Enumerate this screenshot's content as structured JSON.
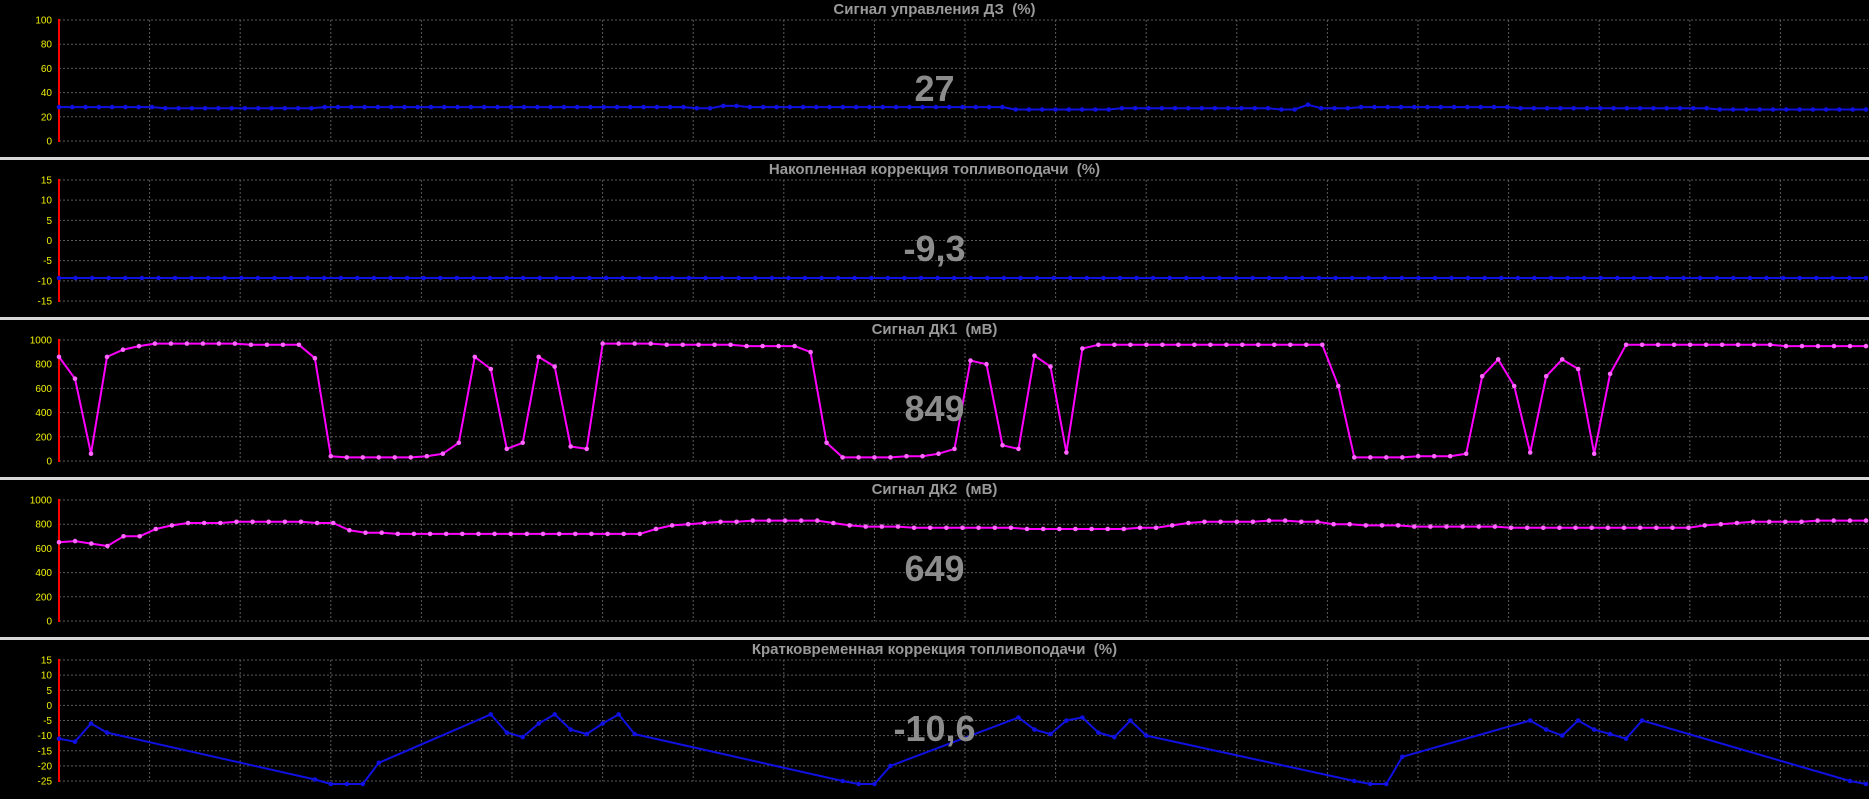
{
  "charts": [
    {
      "title": "Сигнал управления ДЗ  (%)",
      "current_value": "27",
      "colors": {
        "line": "#1010e0",
        "marker": "#1010e0",
        "axis": "#ff0000",
        "tick_label": "#f0f000",
        "grid": "#5a5a5a"
      }
    },
    {
      "title": "Накопленная коррекция топливоподачи  (%)",
      "current_value": "-9,3",
      "colors": {
        "line": "#1010e0",
        "marker": "#1010e0",
        "axis": "#ff0000",
        "tick_label": "#f0f000",
        "grid": "#5a5a5a"
      }
    },
    {
      "title": "Сигнал ДК1  (мВ)",
      "current_value": "849",
      "colors": {
        "line": "#ff00ff",
        "marker": "#ff66ff",
        "axis": "#ff0000",
        "tick_label": "#f0f000",
        "grid": "#5a5a5a"
      }
    },
    {
      "title": "Сигнал ДК2  (мВ)",
      "current_value": "649",
      "colors": {
        "line": "#ff00ff",
        "marker": "#ff66ff",
        "axis": "#ff0000",
        "tick_label": "#f0f000",
        "grid": "#5a5a5a"
      }
    },
    {
      "title": "Кратковременная коррекция топливоподачи  (%)",
      "current_value": "-10,6",
      "colors": {
        "line": "#1010e0",
        "marker": "#1010e0",
        "axis": "#ff0000",
        "tick_label": "#f0f000",
        "grid": "#5a5a5a"
      }
    }
  ],
  "chart_data": [
    {
      "type": "line",
      "title": "Сигнал управления ДЗ  (%)",
      "ylim": [
        0,
        100
      ],
      "yticks": [
        "100",
        "80",
        "60",
        "40",
        "20",
        "0"
      ],
      "grid": true,
      "series": [
        {
          "values": [
            28,
            28,
            28,
            28,
            28,
            28,
            28,
            28,
            27,
            27,
            27,
            27,
            27,
            27,
            27,
            27,
            27,
            27,
            27,
            27,
            28,
            28,
            28,
            28,
            28,
            28,
            28,
            28,
            28,
            28,
            28,
            28,
            28,
            28,
            28,
            28,
            28,
            28,
            28,
            28,
            28,
            28,
            28,
            28,
            28,
            28,
            28,
            28,
            27,
            27,
            29,
            29,
            28,
            28,
            28,
            28,
            28,
            28,
            28,
            28,
            28,
            28,
            28,
            28,
            28,
            28,
            28,
            28,
            28,
            28,
            28,
            28,
            26,
            26,
            26,
            26,
            26,
            26,
            26,
            26,
            27,
            27,
            27,
            27,
            27,
            27,
            27,
            27,
            27,
            27,
            27,
            27,
            26,
            26,
            30,
            27,
            27,
            27,
            28,
            28,
            28,
            28,
            28,
            28,
            28,
            28,
            28,
            28,
            28,
            28,
            27,
            27,
            27,
            27,
            27,
            27,
            27,
            27,
            27,
            27,
            27,
            27,
            27,
            27,
            27,
            26,
            26,
            26,
            26,
            26,
            26,
            26,
            26,
            26,
            26,
            26,
            26
          ]
        }
      ]
    },
    {
      "type": "line",
      "title": "Накопленная коррекция топливоподачи  (%)",
      "ylim": [
        -15,
        15
      ],
      "yticks": [
        "15",
        "10",
        "5",
        "0",
        "-5",
        "-10",
        "-15"
      ],
      "grid": true,
      "series": [
        {
          "values": [
            -9.3,
            -9.3,
            -9.3,
            -9.3,
            -9.3,
            -9.3,
            -9.3,
            -9.3,
            -9.3,
            -9.3,
            -9.3,
            -9.3,
            -9.3,
            -9.3,
            -9.3,
            -9.3,
            -9.3,
            -9.3,
            -9.3,
            -9.3,
            -9.3,
            -9.3,
            -9.3,
            -9.3,
            -9.3,
            -9.3,
            -9.3,
            -9.3,
            -9.3,
            -9.3,
            -9.3,
            -9.3,
            -9.3,
            -9.3,
            -9.3,
            -9.3,
            -9.3,
            -9.3,
            -9.3,
            -9.3,
            -9.3,
            -9.3,
            -9.3,
            -9.3,
            -9.3,
            -9.3,
            -9.3,
            -9.3,
            -9.3,
            -9.3,
            -9.3,
            -9.3,
            -9.3,
            -9.3,
            -9.3,
            -9.3,
            -9.3,
            -9.3,
            -9.3,
            -9.3,
            -9.3,
            -9.3,
            -9.3,
            -9.3,
            -9.3,
            -9.3,
            -9.3,
            -9.3,
            -9.3,
            -9.3,
            -9.3,
            -9.3,
            -9.3,
            -9.3,
            -9.3,
            -9.3,
            -9.3,
            -9.3,
            -9.3,
            -9.3,
            -9.3,
            -9.3,
            -9.3,
            -9.3,
            -9.3,
            -9.3,
            -9.3,
            -9.3,
            -9.3,
            -9.3,
            -9.3,
            -9.3,
            -9.3,
            -9.3,
            -9.3,
            -9.3,
            -9.3,
            -9.3,
            -9.3,
            -9.3,
            -9.3,
            -9.3,
            -9.3,
            -9.3,
            -9.3,
            -9.3,
            -9.3,
            -9.3,
            -9.3,
            -9.3
          ]
        }
      ]
    },
    {
      "type": "line",
      "title": "Сигнал ДК1  (мВ)",
      "ylim": [
        0,
        1000
      ],
      "yticks": [
        "1000",
        "800",
        "600",
        "400",
        "200",
        "0"
      ],
      "grid": true,
      "series": [
        {
          "values": [
            860,
            680,
            60,
            860,
            920,
            950,
            970,
            970,
            970,
            970,
            970,
            970,
            960,
            960,
            960,
            960,
            850,
            40,
            30,
            30,
            30,
            30,
            30,
            40,
            60,
            150,
            860,
            760,
            100,
            150,
            860,
            780,
            120,
            100,
            970,
            970,
            970,
            970,
            960,
            960,
            960,
            960,
            960,
            950,
            950,
            950,
            950,
            900,
            150,
            30,
            30,
            30,
            30,
            40,
            40,
            60,
            100,
            830,
            800,
            130,
            100,
            870,
            780,
            70,
            930,
            960,
            960,
            960,
            960,
            960,
            960,
            960,
            960,
            960,
            960,
            960,
            960,
            960,
            960,
            960,
            620,
            30,
            30,
            30,
            30,
            40,
            40,
            40,
            60,
            700,
            840,
            620,
            70,
            700,
            840,
            760,
            60,
            720,
            960,
            960,
            960,
            960,
            960,
            960,
            960,
            960,
            960,
            960,
            950,
            950,
            950,
            950,
            950,
            950
          ]
        }
      ]
    },
    {
      "type": "line",
      "title": "Сигнал ДК2  (мВ)",
      "ylim": [
        0,
        1000
      ],
      "yticks": [
        "1000",
        "800",
        "600",
        "400",
        "200",
        "0"
      ],
      "grid": true,
      "series": [
        {
          "values": [
            650,
            660,
            640,
            620,
            700,
            700,
            760,
            790,
            810,
            810,
            810,
            820,
            820,
            820,
            820,
            820,
            810,
            810,
            750,
            730,
            730,
            720,
            720,
            720,
            720,
            720,
            720,
            720,
            720,
            720,
            720,
            720,
            720,
            720,
            720,
            720,
            720,
            760,
            790,
            800,
            810,
            820,
            820,
            830,
            830,
            830,
            830,
            830,
            810,
            790,
            780,
            780,
            780,
            770,
            770,
            770,
            770,
            770,
            770,
            770,
            760,
            760,
            760,
            760,
            760,
            760,
            760,
            770,
            770,
            790,
            810,
            820,
            820,
            820,
            820,
            830,
            830,
            820,
            820,
            800,
            800,
            790,
            790,
            790,
            780,
            780,
            780,
            780,
            780,
            780,
            770,
            770,
            770,
            770,
            770,
            770,
            770,
            770,
            770,
            770,
            770,
            770,
            790,
            800,
            810,
            820,
            820,
            820,
            820,
            830,
            830,
            830,
            830
          ]
        }
      ]
    },
    {
      "type": "line",
      "title": "Кратковременная коррекция топливоподачи  (%)",
      "ylim": [
        -25,
        15
      ],
      "yticks": [
        "15",
        "10",
        "5",
        "0",
        "-5",
        "-10",
        "-15",
        "-20",
        "-25"
      ],
      "grid": true,
      "series": [
        {
          "values": [
            [
              0,
              -11
            ],
            [
              1,
              -12
            ],
            [
              2,
              -6
            ],
            [
              3,
              -9
            ],
            [
              16,
              -24.5
            ],
            [
              17,
              -26
            ],
            [
              18,
              -26
            ],
            [
              19,
              -26
            ],
            [
              20,
              -19
            ],
            [
              27,
              -3
            ],
            [
              28,
              -9
            ],
            [
              29,
              -10.5
            ],
            [
              30,
              -6
            ],
            [
              31,
              -3
            ],
            [
              32,
              -8
            ],
            [
              33,
              -9.5
            ],
            [
              34,
              -6
            ],
            [
              35,
              -3
            ],
            [
              36,
              -9.5
            ],
            [
              49,
              -25
            ],
            [
              50,
              -26
            ],
            [
              51,
              -26
            ],
            [
              52,
              -20
            ],
            [
              60,
              -4
            ],
            [
              61,
              -8
            ],
            [
              62,
              -9.5
            ],
            [
              63,
              -5
            ],
            [
              64,
              -4
            ],
            [
              65,
              -9
            ],
            [
              66,
              -10.5
            ],
            [
              67,
              -5
            ],
            [
              68,
              -10
            ],
            [
              81,
              -25
            ],
            [
              82,
              -26
            ],
            [
              83,
              -26
            ],
            [
              84,
              -17
            ],
            [
              92,
              -5
            ],
            [
              93,
              -8
            ],
            [
              94,
              -10
            ],
            [
              95,
              -5
            ],
            [
              96,
              -8
            ],
            [
              97,
              -9.5
            ],
            [
              98,
              -11
            ],
            [
              99,
              -5
            ],
            [
              112,
              -25
            ],
            [
              113,
              -26
            ]
          ]
        }
      ]
    }
  ]
}
